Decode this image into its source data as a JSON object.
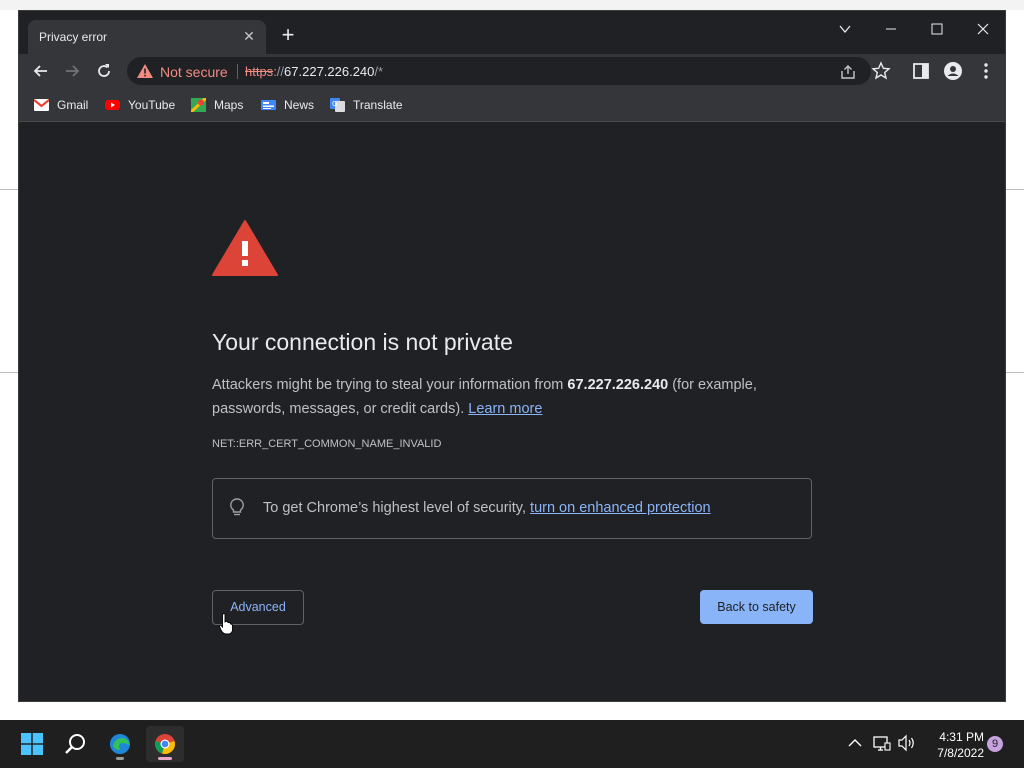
{
  "window": {
    "tab_title": "Privacy error"
  },
  "omnibox": {
    "security_label": "Not secure",
    "url_scheme": "https",
    "url_sep": "://",
    "url_host": "67.227.226.240",
    "url_path": "/*"
  },
  "bookmarks": [
    {
      "label": "Gmail",
      "icon": "gmail-icon"
    },
    {
      "label": "YouTube",
      "icon": "youtube-icon"
    },
    {
      "label": "Maps",
      "icon": "maps-icon"
    },
    {
      "label": "News",
      "icon": "news-icon"
    },
    {
      "label": "Translate",
      "icon": "translate-icon"
    }
  ],
  "error": {
    "heading": "Your connection is not private",
    "desc_before": "Attackers might be trying to steal your information from ",
    "host": "67.227.226.240",
    "desc_after": " (for example, passwords, messages, or credit cards). ",
    "learn_more": "Learn more",
    "code": "NET::ERR_CERT_COMMON_NAME_INVALID",
    "security_text": "To get Chrome’s highest level of security, ",
    "security_link": "turn on enhanced protection",
    "advanced_label": "Advanced",
    "back_label": "Back to safety"
  },
  "taskbar": {
    "time": "4:31 PM",
    "date": "7/8/2022",
    "notifications": "9"
  },
  "colors": {
    "page_bg": "#202124",
    "warning_red": "#db4437",
    "link_blue": "#8ab4f8",
    "not_secure_red": "#f28b82"
  }
}
